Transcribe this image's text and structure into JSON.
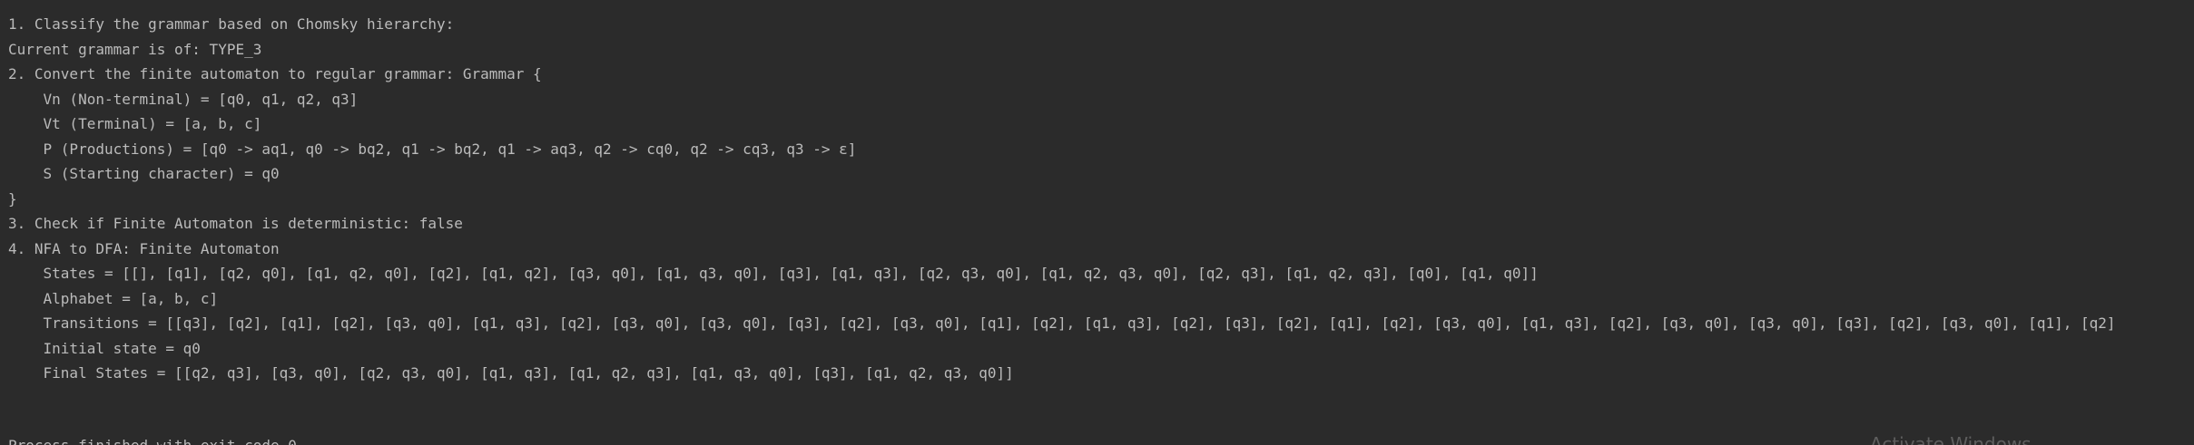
{
  "console": {
    "lines": [
      "1. Classify the grammar based on Chomsky hierarchy:",
      "Current grammar is of: TYPE_3",
      "2. Convert the finite automaton to regular grammar: Grammar {",
      "    Vn (Non-terminal) = [q0, q1, q2, q3]",
      "    Vt (Terminal) = [a, b, c]",
      "    P (Productions) = [q0 -> aq1, q0 -> bq2, q1 -> bq2, q1 -> aq3, q2 -> cq0, q2 -> cq3, q3 -> ε]",
      "    S (Starting character) = q0",
      "}",
      "3. Check if Finite Automaton is deterministic: false",
      "4. NFA to DFA: Finite Automaton",
      "    States = [[], [q1], [q2, q0], [q1, q2, q0], [q2], [q1, q2], [q3, q0], [q1, q3, q0], [q3], [q1, q3], [q2, q3, q0], [q1, q2, q3, q0], [q2, q3], [q1, q2, q3], [q0], [q1, q0]]",
      "    Alphabet = [a, b, c]",
      "    Transitions = [[q3], [q2], [q1], [q2], [q3, q0], [q1, q3], [q2], [q3, q0], [q3, q0], [q3], [q2], [q3, q0], [q1], [q2], [q1, q3], [q2], [q3], [q2], [q1], [q2], [q3, q0], [q1, q3], [q2], [q3, q0], [q3, q0], [q3], [q2], [q3, q0], [q1], [q2]",
      "    Initial state = q0",
      "    Final States = [[q2, q3], [q3, q0], [q2, q3, q0], [q1, q3], [q1, q2, q3], [q1, q3, q0], [q3], [q1, q2, q3, q0]]"
    ],
    "exit_message": "Process finished with exit code 0"
  },
  "watermark": {
    "text": "Activate Windows"
  }
}
